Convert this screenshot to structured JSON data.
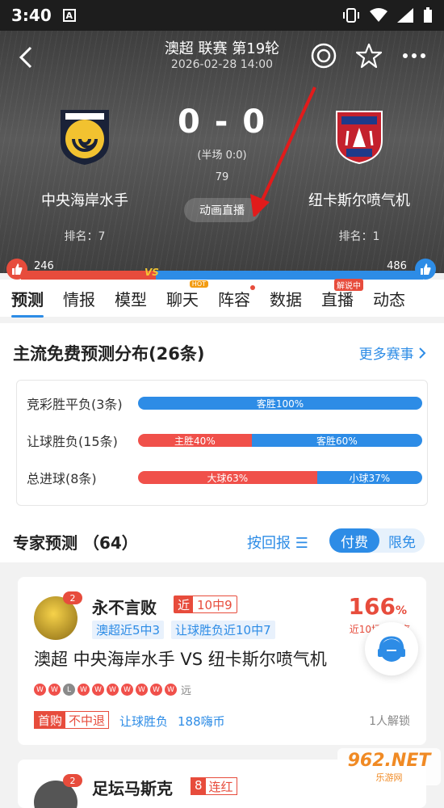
{
  "status_bar": {
    "time": "3:40",
    "a_icon": "A"
  },
  "header": {
    "league": "澳超  联赛 第19轮",
    "datetime": "2026-02-28 14:00"
  },
  "match": {
    "home": {
      "name": "中央海岸水手",
      "rank": "排名：7"
    },
    "away": {
      "name": "纽卡斯尔喷气机",
      "rank": "排名：1"
    },
    "score": "0 - 0",
    "halftime": "(半场 0:0)",
    "minute": "79",
    "animation_button": "动画直播"
  },
  "vote": {
    "home_count": "246",
    "away_count": "486",
    "vs": "VS",
    "home_share": 0.336
  },
  "tabs": [
    {
      "label": "预测"
    },
    {
      "label": "情报"
    },
    {
      "label": "模型"
    },
    {
      "label": "聊天",
      "badge": "HOT"
    },
    {
      "label": "阵容"
    },
    {
      "label": "数据"
    },
    {
      "label": "直播",
      "badge": "解说中"
    },
    {
      "label": "动态"
    }
  ],
  "prediction_dist": {
    "title": "主流免费预测分布(26条)",
    "more": "更多赛事",
    "rows": [
      {
        "label": "竞彩胜平负(3条)",
        "segments": [
          {
            "text": "客胜100%",
            "pct": 100,
            "color": "blue"
          }
        ]
      },
      {
        "label": "让球胜负(15条)",
        "segments": [
          {
            "text": "主胜40%",
            "pct": 40,
            "color": "red"
          },
          {
            "text": "客胜60%",
            "pct": 60,
            "color": "blue"
          }
        ]
      },
      {
        "label": "总进球(8条)",
        "segments": [
          {
            "text": "大球63%",
            "pct": 63,
            "color": "red"
          },
          {
            "text": "小球37%",
            "pct": 37,
            "color": "blue"
          }
        ]
      }
    ]
  },
  "experts": {
    "title": "专家预测 （64）",
    "sort": "按回报 ☰",
    "toggle_paid": "付费",
    "toggle_free": "限免",
    "cards": [
      {
        "badge": "2",
        "name": "永不言败",
        "streak_a": "近",
        "streak_b": "10中9",
        "tag1": "澳超近5中3",
        "tag2": "让球胜负近10中7",
        "rate": "166",
        "rate_unit": "%",
        "rate_sub": "近10场回报率",
        "match_line": "澳超 中央海岸水手 VS 纽卡斯尔喷气机",
        "results": [
          "W",
          "W",
          "L",
          "W",
          "W",
          "W",
          "W",
          "W",
          "W",
          "W"
        ],
        "far": "远",
        "first_a": "首购",
        "first_b": "不中退",
        "play": "让球胜负",
        "coin": "188嗨币",
        "unlock": "1人解锁"
      },
      {
        "badge": "2",
        "name": "足坛马斯克",
        "streak_a": "8",
        "streak_b": "连红"
      }
    ]
  },
  "watermark": {
    "line1": "962.NET",
    "line2": "乐游网"
  }
}
